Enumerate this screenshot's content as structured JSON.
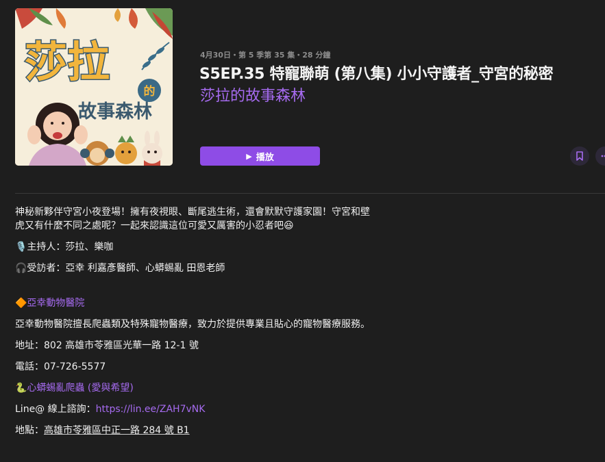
{
  "episode": {
    "meta": "4月30日・第 5 季第 35 集・28 分鐘",
    "title": "S5EP.35 特寵聯萌 (第八集) 小小守護者_守宮的秘密",
    "show": "莎拉的故事森林",
    "play_label": "播放",
    "play_icon": "▶",
    "bookmark_icon": "bookmark-icon",
    "more_icon": "more-icon"
  },
  "artwork": {
    "line1": "莎拉",
    "badge": "的",
    "line2": "故事森林"
  },
  "description": {
    "intro": "神秘新夥伴守宮小夜登場！擁有夜視眼、斷尾逃生術，還會默默守護家園！守宮和壁虎又有什麼不同之處呢？一起來認識這位可愛又厲害的小忍者吧😆",
    "host": "🎙️主持人：莎拉、樂咖",
    "guest": "🎧受訪者：亞幸 利嘉彥醫師、心蟒蜴亂 田恩老師",
    "clinic_name": "🔶亞幸動物醫院",
    "clinic_desc": "亞幸動物醫院擅長爬蟲類及特殊寵物醫療，致力於提供專業且貼心的寵物醫療服務。",
    "clinic_address": "地址：802 高雄市苓雅區光華一路 12-1 號",
    "clinic_phone": "電話：07-726-5577",
    "reptile_shop": "🐍心蟒蜴亂爬蟲 (愛與希望)",
    "line_label": "Line@ 線上諮詢：",
    "line_url": "https://lin.ee/ZAH7vNK",
    "shop_address_label": "地點：",
    "shop_address": "高雄市苓雅區中正一路 284 號 B1"
  },
  "colors": {
    "accent": "#8e4ce6",
    "link": "#a66bf0",
    "background": "#1e1e1e"
  }
}
